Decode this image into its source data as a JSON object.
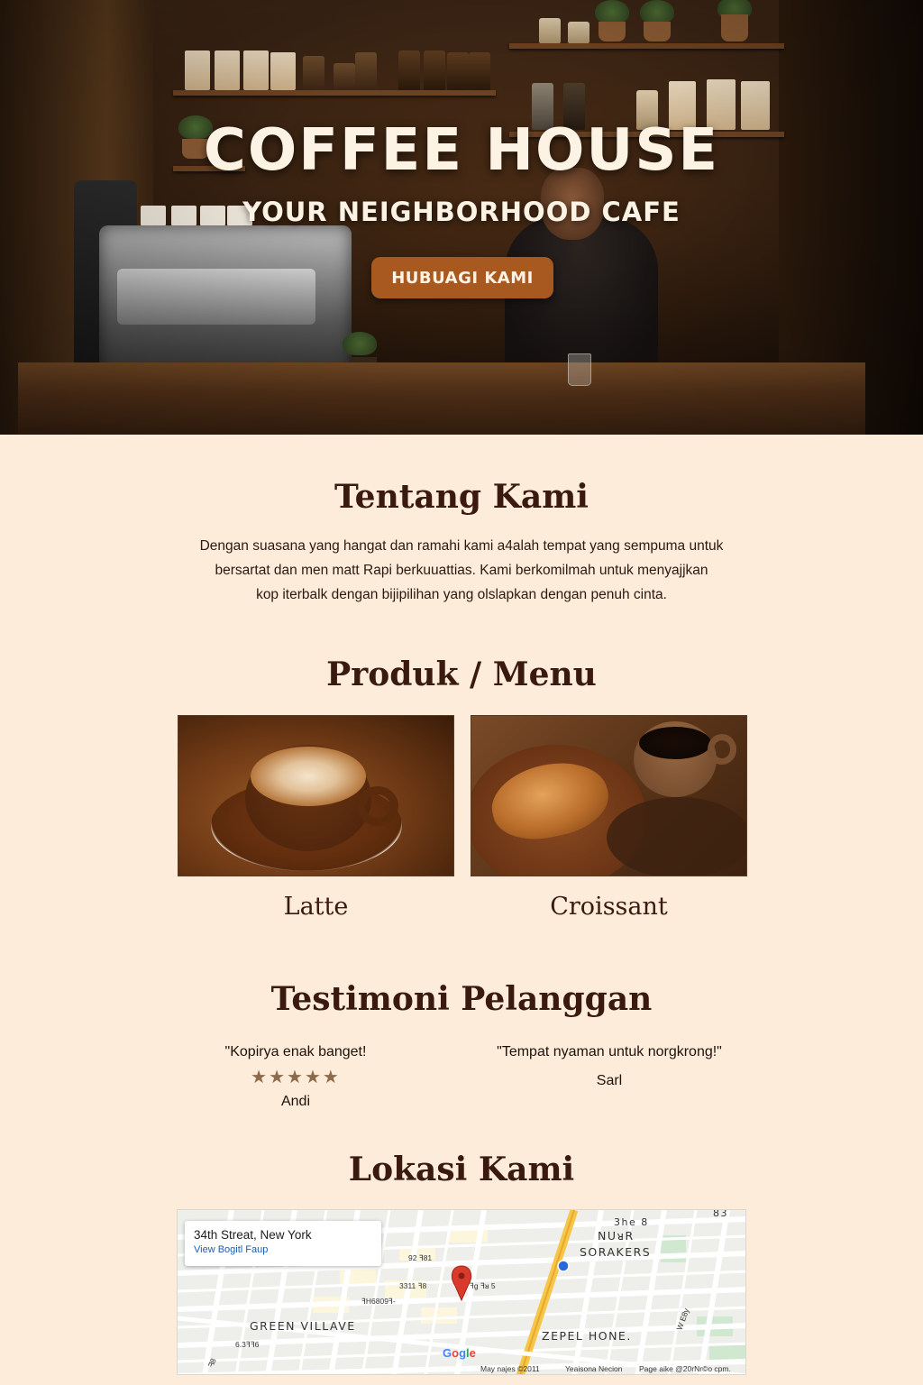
{
  "hero": {
    "title": "COFFEE HOUSE",
    "subtitle": "YOUR NEIGHBORHOOD CAFE",
    "cta_label": "HUBUAGI KAMI"
  },
  "about": {
    "title": "Tentang Kami",
    "lines": [
      "Dengan suasana yang hangat dan ramahi kami a4alah tempat yang sempuma untuk",
      "bersartat dan men matt Rapi berkuuattias. Kami berkomilmah untuk menyajjkan",
      "kop iterbalk dengan bijipilihan yang olslapkan dengan penuh cinta."
    ]
  },
  "menu": {
    "title": "Produk / Menu",
    "items": [
      {
        "name": "Latte"
      },
      {
        "name": "Croissant"
      }
    ]
  },
  "testimonials": {
    "title": "Testimoni Pelanggan",
    "items": [
      {
        "quote": "\"Kopirya enak banget!",
        "stars": "★★★★★",
        "rating": 5,
        "name": "Andi"
      },
      {
        "quote": "\"Tempat nyaman untuk norgkrong!\"",
        "name": "Sarl"
      }
    ]
  },
  "location": {
    "title": "Lokasi Kami",
    "map": {
      "card_title": "34th Streat, New York",
      "card_link": "View Bogitl Faup",
      "labels": {
        "nuor": "NUᴚR",
        "sorakers": "SORAKERS",
        "green_villave": "GREEN VILLAVE",
        "zepel_hone": "ZEPEL HONE.",
        "the8": "3he 8",
        "s3": "83",
        "street_a": "92 ꟻ81",
        "street_b": "3311 ꟻ8",
        "street_c": "ꟻH6809ꟻ-",
        "street_d": "ꟻg ꟻᴚ 5",
        "street_e": "6.3ꟻꟻ6",
        "street_f": "W E8y",
        "street_g": "ᖷ8"
      },
      "google": [
        "G",
        "o",
        "g",
        "l",
        "e"
      ],
      "footer": [
        "May najes ©2011",
        "Yeaisona Necion",
        "Page aike @20rNr©o cpm."
      ]
    }
  },
  "colors": {
    "background": "#fcecd9",
    "heading": "#3a1a0e",
    "cta": "#a8591f",
    "star": "#8c6a4c"
  }
}
